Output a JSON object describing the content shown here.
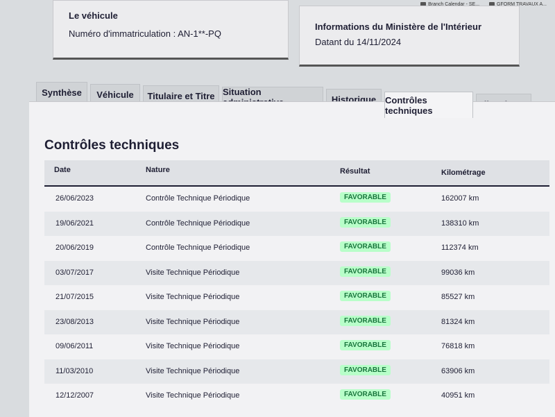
{
  "browser": {
    "bookmarks": [
      {
        "label": "Branch Calendar - SE..."
      },
      {
        "label": "GFORM TRAVAUX A..."
      }
    ]
  },
  "vehicle_card": {
    "title": "Le véhicule",
    "registration": "Numéro d'immatriculation : AN-1**-PQ"
  },
  "ministry_card": {
    "title": "Informations du Ministère de l'Intérieur",
    "date": "Datant du 14/11/2024"
  },
  "tabs": [
    {
      "label": "Synthèse",
      "active": false
    },
    {
      "label": "Véhicule",
      "active": false
    },
    {
      "label": "Titulaire et Titre",
      "active": false
    },
    {
      "label": "Situation administrative",
      "active": false
    },
    {
      "label": "Historique",
      "active": false
    },
    {
      "label": "Contrôles techniques",
      "active": true
    },
    {
      "label": "Kilométrage",
      "active": false
    }
  ],
  "section": {
    "title": "Contrôles techniques"
  },
  "table": {
    "columns": [
      "Date",
      "Nature",
      "Résultat",
      "Kilométrage"
    ],
    "rows": [
      {
        "date": "26/06/2023",
        "nature": "Contrôle Technique Périodique",
        "result": "FAVORABLE",
        "km": "162007 km"
      },
      {
        "date": "19/06/2021",
        "nature": "Contrôle Technique Périodique",
        "result": "FAVORABLE",
        "km": "138310 km"
      },
      {
        "date": "20/06/2019",
        "nature": "Contrôle Technique Périodique",
        "result": "FAVORABLE",
        "km": "112374 km"
      },
      {
        "date": "03/07/2017",
        "nature": "Visite Technique Périodique",
        "result": "FAVORABLE",
        "km": "99036 km"
      },
      {
        "date": "21/07/2015",
        "nature": "Visite Technique Périodique",
        "result": "FAVORABLE",
        "km": "85527 km"
      },
      {
        "date": "23/08/2013",
        "nature": "Visite Technique Périodique",
        "result": "FAVORABLE",
        "km": "81324 km"
      },
      {
        "date": "09/06/2011",
        "nature": "Visite Technique Périodique",
        "result": "FAVORABLE",
        "km": "76818 km"
      },
      {
        "date": "11/03/2010",
        "nature": "Visite Technique Périodique",
        "result": "FAVORABLE",
        "km": "63906 km"
      },
      {
        "date": "12/12/2007",
        "nature": "Visite Technique Périodique",
        "result": "FAVORABLE",
        "km": "40951 km"
      }
    ]
  },
  "colors": {
    "text": "#1e1e33",
    "badge_bg": "#b8fec9",
    "badge_text": "#18753c"
  }
}
